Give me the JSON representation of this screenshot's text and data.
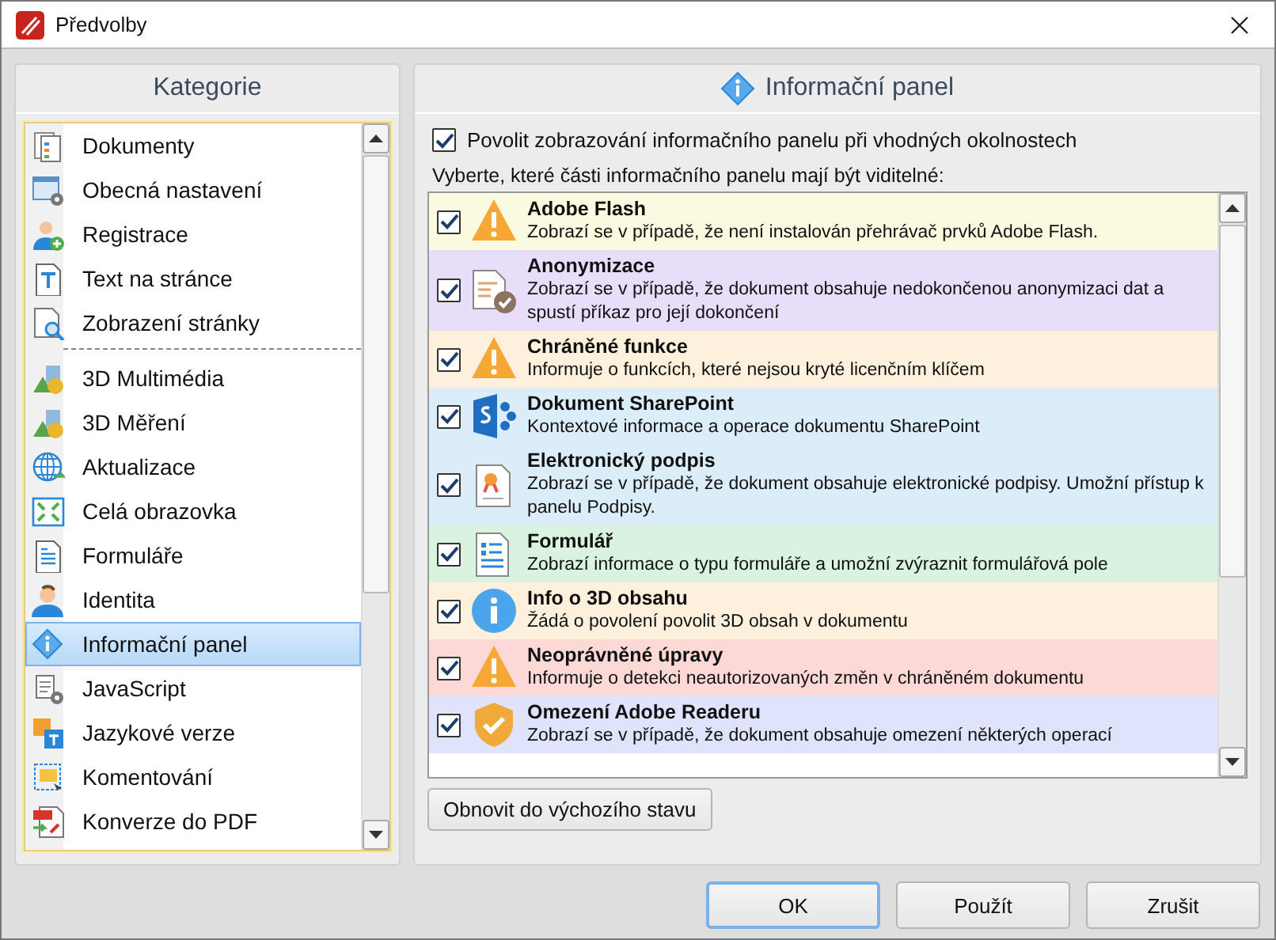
{
  "window": {
    "title": "Předvolby"
  },
  "categories": {
    "title": "Kategorie",
    "groups": [
      {
        "items": [
          {
            "label": "Dokumenty",
            "selected": false
          },
          {
            "label": "Obecná nastavení",
            "selected": false
          },
          {
            "label": "Registrace",
            "selected": false
          },
          {
            "label": "Text na stránce",
            "selected": false
          },
          {
            "label": "Zobrazení stránky",
            "selected": false
          }
        ]
      },
      {
        "items": [
          {
            "label": "3D Multimédia",
            "selected": false
          },
          {
            "label": "3D Měření",
            "selected": false
          },
          {
            "label": "Aktualizace",
            "selected": false
          },
          {
            "label": "Celá obrazovka",
            "selected": false
          },
          {
            "label": "Formuláře",
            "selected": false
          },
          {
            "label": "Identita",
            "selected": false
          },
          {
            "label": "Informační panel",
            "selected": true
          },
          {
            "label": "JavaScript",
            "selected": false
          },
          {
            "label": "Jazykové verze",
            "selected": false
          },
          {
            "label": "Komentování",
            "selected": false
          },
          {
            "label": "Konverze do PDF",
            "selected": false
          }
        ]
      }
    ]
  },
  "panel": {
    "title": "Informační panel",
    "enable": {
      "label": "Povolit zobrazování informačního panelu při vhodných okolnostech",
      "checked": true
    },
    "list_label": "Vyberte, které části informačního panelu mají být viditelné:",
    "items": [
      {
        "title": "Adobe Flash",
        "description": "Zobrazí se v případě, že není instalován přehrávač prvků Adobe Flash.",
        "checked": true,
        "color": "#fafae0"
      },
      {
        "title": "Anonymizace",
        "description": "Zobrazí se v případě, že dokument obsahuje nedokončenou anonymizaci dat a spustí příkaz pro její dokončení",
        "checked": true,
        "color": "#e8defa"
      },
      {
        "title": "Chráněné funkce",
        "description": "Informuje o funkcích, které nejsou kryté licenčním klíčem",
        "checked": true,
        "color": "#fdf0dc"
      },
      {
        "title": "Dokument SharePoint",
        "description": "Kontextové informace a operace dokumentu SharePoint",
        "checked": true,
        "color": "#dcedfa"
      },
      {
        "title": "Elektronický podpis",
        "description": "Zobrazí se v případě, že dokument obsahuje elektronické podpisy. Umožní přístup k panelu Podpisy.",
        "checked": true,
        "color": "#dcedfa"
      },
      {
        "title": "Formulář",
        "description": "Zobrazí informace o typu formuláře a umožní zvýraznit formulářová pole",
        "checked": true,
        "color": "#daf3e0"
      },
      {
        "title": "Info o 3D obsahu",
        "description": "Žádá o povolení povolit 3D obsah v dokumentu",
        "checked": true,
        "color": "#fdf0dc"
      },
      {
        "title": "Neoprávněné úpravy",
        "description": "Informuje o detekci neautorizovaných změn v chráněném dokumentu",
        "checked": true,
        "color": "#fcd9d6"
      },
      {
        "title": "Omezení Adobe Readeru",
        "description": "Zobrazí se v případě, že dokument obsahuje omezení některých operací",
        "checked": true,
        "color": "#dfe3fb"
      }
    ],
    "reset_button": "Obnovit do výchozího stavu"
  },
  "buttons": [
    {
      "label": "OK",
      "default": true
    },
    {
      "label": "Použít",
      "default": false
    },
    {
      "label": "Zrušit",
      "default": false
    }
  ]
}
